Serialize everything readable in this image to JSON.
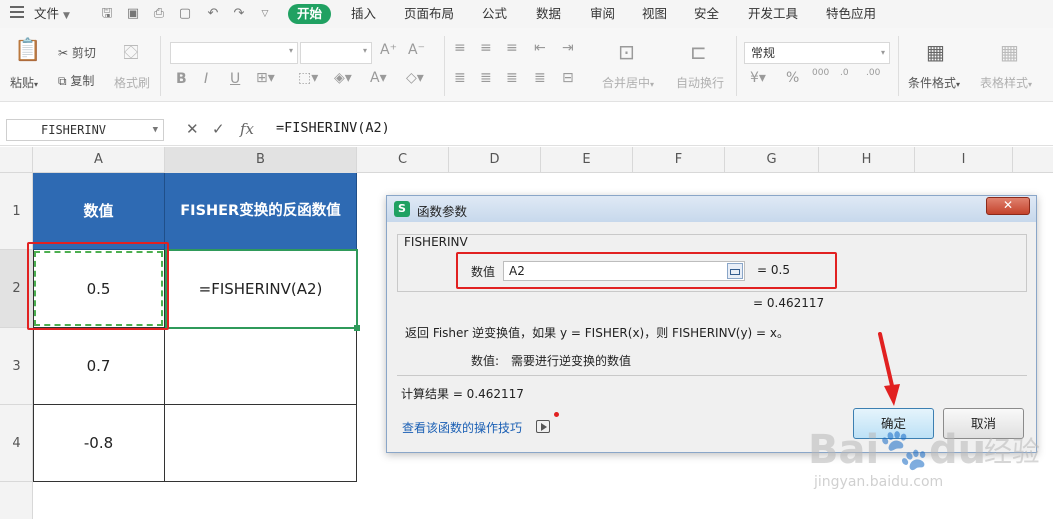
{
  "menubar": {
    "file_label": "文件",
    "tabs": [
      "开始",
      "插入",
      "页面布局",
      "公式",
      "数据",
      "审阅",
      "视图",
      "安全",
      "开发工具",
      "特色应用"
    ],
    "active_tab": "开始"
  },
  "ribbon": {
    "paste": "粘贴",
    "cut": "剪切",
    "copy": "复制",
    "format_painter": "格式刷",
    "merge_center": "合并居中",
    "wrap_text": "自动换行",
    "number_format": "常规",
    "conditional_format": "条件格式",
    "table_style": "表格样式"
  },
  "formula_bar": {
    "name_box": "FISHERINV",
    "fx": "fx",
    "formula": "=FISHERINV(A2)"
  },
  "columns": [
    "A",
    "B",
    "C",
    "D",
    "E",
    "F",
    "G",
    "H",
    "I"
  ],
  "rows": [
    "1",
    "2",
    "3",
    "4"
  ],
  "sheet": {
    "a1": "数值",
    "b1": "FISHER变换的反函数值",
    "a2": "0.5",
    "b2": "=FISHERINV(A2)",
    "a3": "0.7",
    "a4": "-0.8"
  },
  "dialog": {
    "title": "函数参数",
    "close": "✕",
    "function_name": "FISHERINV",
    "arg_label": "数值",
    "arg_value": "A2",
    "arg_result": "= 0.5",
    "function_result": "= 0.462117",
    "description": "返回 Fisher 逆变换值，如果 y = FISHER(x)，则 FISHERINV(y) = x。",
    "arg_desc_label": "数值:",
    "arg_desc": "需要进行逆变换的数值",
    "calc_result": "计算结果 = 0.462117",
    "help_link": "查看该函数的操作技巧",
    "ok": "确定",
    "cancel": "取消"
  },
  "watermark": {
    "brand": "Bai",
    "brand2": "du",
    "cn": "经验",
    "url": "jingyan.baidu.com"
  },
  "colors": {
    "accent": "#20a162",
    "header_fill": "#2e6ab3",
    "highlight": "#e12121",
    "link": "#1a5fb4"
  }
}
